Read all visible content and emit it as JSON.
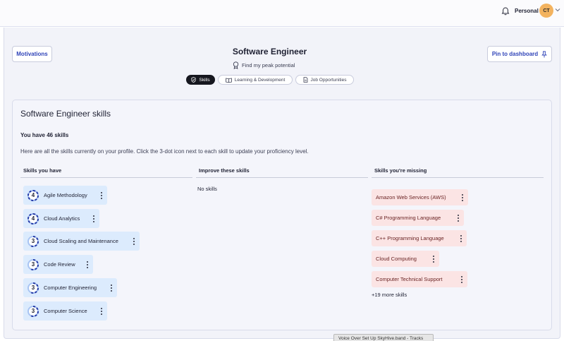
{
  "header": {
    "profile_label": "Personal",
    "avatar_initials": "CT"
  },
  "page": {
    "motivations_label": "Motivations",
    "pin_label": "Pin to dashboard",
    "title": "Software Engineer",
    "subtitle": "Find my peak potential"
  },
  "tabs": [
    {
      "label": "Skills",
      "active": true
    },
    {
      "label": "Learning & Development",
      "active": false
    },
    {
      "label": "Job Opportunities",
      "active": false
    }
  ],
  "skills_card": {
    "title": "Software Engineer skills",
    "count_text": "You have 46 skills",
    "description": "Here are all the skills currently on your profile. Click the 3-dot icon next to each skill to update your proficiency level.",
    "columns": {
      "have": "Skills you have",
      "improve": "Improve these skills",
      "missing": "Skills you're missing"
    },
    "skills_have": [
      {
        "name": "Agile Methodology",
        "level": "4"
      },
      {
        "name": "Cloud Analytics",
        "level": "4"
      },
      {
        "name": "Cloud Scaling and Maintenance",
        "level": "3"
      },
      {
        "name": "Code Review",
        "level": "3"
      },
      {
        "name": "Computer Engineering",
        "level": "3"
      },
      {
        "name": "Computer Science",
        "level": "3"
      }
    ],
    "improve_empty": "No skills",
    "skills_missing": [
      "Amazon Web Services (AWS)",
      "C# Programming Language",
      "C++ Programming Language",
      "Cloud Computing",
      "Computer Technical Support"
    ],
    "more_link": "+19 more skills"
  },
  "tooltip": "Voice Over Set Up SkyHive.band - Tracks",
  "colors": {
    "accent": "#2f43b8",
    "skill_chip": "#dcebfd",
    "missing_chip": "#fbe4e4",
    "avatar": "#f3b35f",
    "active_tab": "#16171f"
  }
}
